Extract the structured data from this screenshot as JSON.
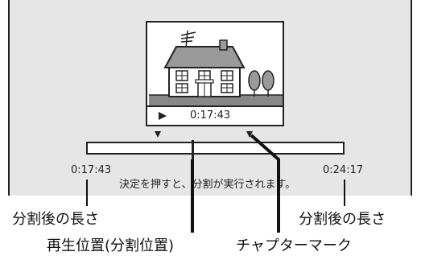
{
  "preview": {
    "time": "0:17:43"
  },
  "timeline": {
    "left_length": "0:17:43",
    "right_length": "0:24:17",
    "message": "決定を押すと、分割が実行されます。"
  },
  "callouts": {
    "split_length_left": "分割後の長さ",
    "split_length_right": "分割後の長さ",
    "playback_position": "再生位置(分割位置)",
    "chapter_mark": "チャプターマーク"
  }
}
